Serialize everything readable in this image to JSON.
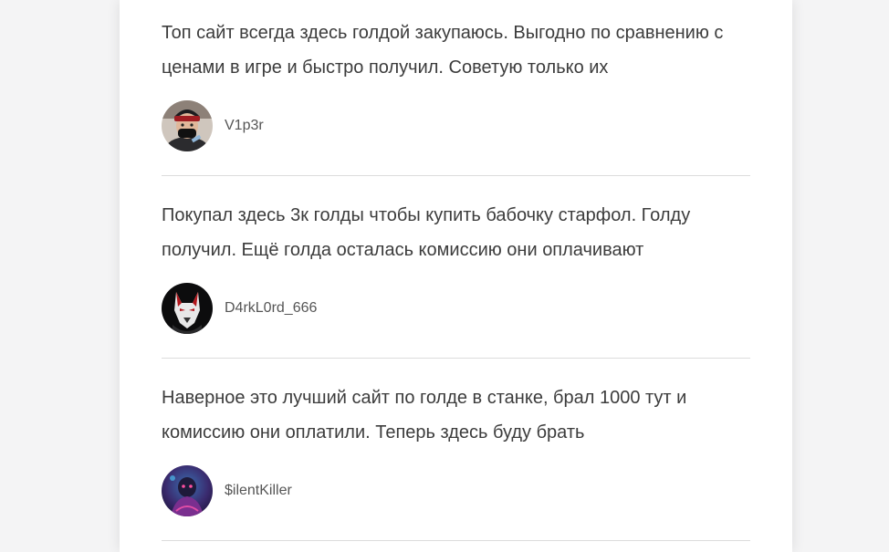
{
  "reviews": [
    {
      "text": "Топ сайт всегда здесь голдой закупаюсь. Выгодно по сравнению с ценами в игре и быстро получил. Советую только их",
      "author": "V1p3r",
      "avatar_icon": "avatar-masked-man-icon"
    },
    {
      "text": "Покупал здесь 3к голды чтобы купить бабочку старфол. Голду получил. Ещё голда осталась комиссию они оплачивают",
      "author": "D4rkL0rd_666",
      "avatar_icon": "avatar-wolf-icon"
    },
    {
      "text": "Наверное это лучший сайт по голде в станке, брал 1000 тут и комиссию они оплатили. Теперь здесь буду брать",
      "author": "$ilentKiller",
      "avatar_icon": "avatar-neon-character-icon"
    }
  ]
}
